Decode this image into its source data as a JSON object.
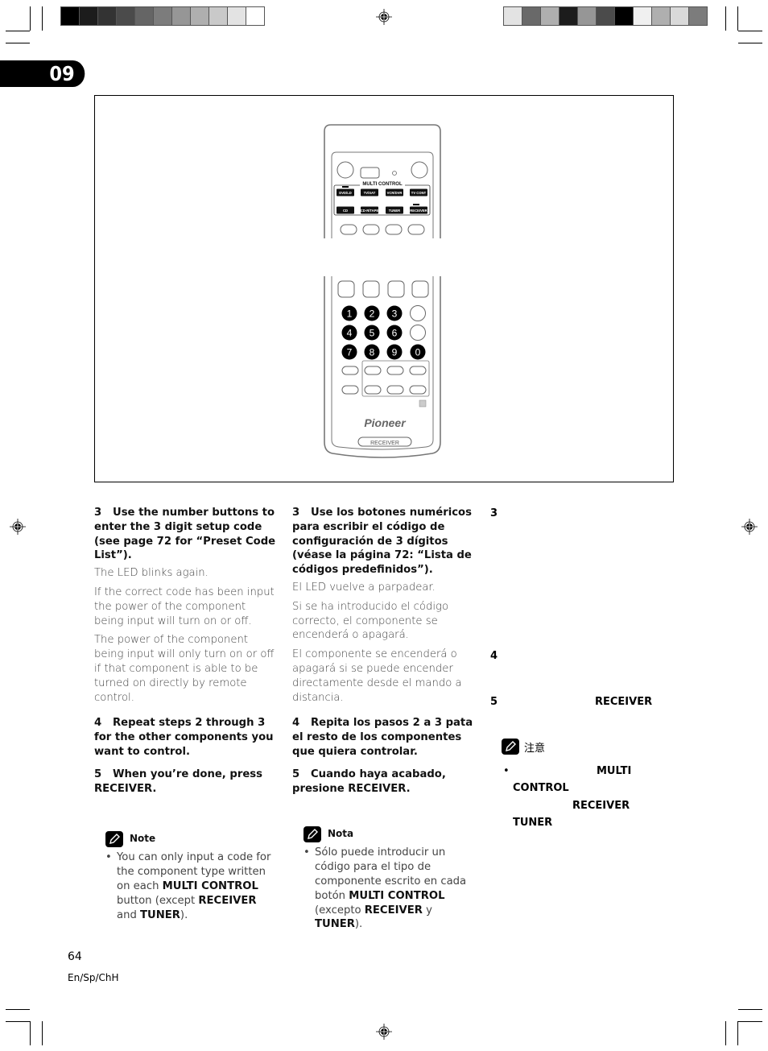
{
  "chapter": "09",
  "color_bar_left": [
    "#000000",
    "#1c1c1c",
    "#333333",
    "#4b4b4b",
    "#656565",
    "#7c7c7c",
    "#969696",
    "#afafaf",
    "#c9c9c9",
    "#e3e3e3",
    "#ffffff"
  ],
  "color_bar_right": [
    "#e3e3e3",
    "#696969",
    "#afafaf",
    "#1c1c1c",
    "#969696",
    "#4b4b4b",
    "#000000",
    "#f0f0f0",
    "#afafaf",
    "#d9d9d9",
    "#7c7c7c"
  ],
  "remote": {
    "multi_control_label": "MULTI CONTROL",
    "row1": [
      "DVD/LD",
      "TV/SAT",
      "VCR/DVR",
      "TV CONT"
    ],
    "row2": [
      "CD",
      "CD-R/TAPE",
      "TUNER",
      "RECEIVER"
    ],
    "numbers": [
      "1",
      "2",
      "3",
      "4",
      "5",
      "6",
      "7",
      "8",
      "9",
      "0"
    ],
    "brand": "Pioneer",
    "receiver_button": "RECEIVER"
  },
  "english": {
    "step3_num": "3",
    "step3_title": "Use the number buttons to enter the 3 digit setup code (see page 72 for “Preset Code List”).",
    "step3_p1": "The LED blinks again.",
    "step3_p2": "If the correct code has been input the power of the component being input will turn on or off.",
    "step3_p3": "The power of the component being input will only turn on or off if that component is able to be turned on directly by remote control.",
    "step4_num": "4",
    "step4_title": "Repeat steps 2 through 3 for the other components you want to control.",
    "step5_num": "5",
    "step5_title": "When you’re done, press RECEIVER.",
    "note_label": "Note",
    "note_text_1": "You can only input a code for the component type written on each ",
    "note_bold_1": "MULTI CONTROL",
    "note_text_2": " button (except ",
    "note_bold_2": "RECEIVER",
    "note_text_3": " and ",
    "note_bold_3": "TUNER",
    "note_text_4": ")."
  },
  "spanish": {
    "step3_num": "3",
    "step3_title": "Use los botones numéricos para escribir el código de configuración de 3 dígitos (véase la página 72: “Lista de códigos predefinidos”).",
    "step3_p1": "El LED vuelve a parpadear.",
    "step3_p2": "Si se ha introducido el código correcto, el componente se encenderá o apagará.",
    "step3_p3": "El componente se encenderá o apagará si se puede encender directamente desde el mando a distancia.",
    "step4_num": "4",
    "step4_title": "Repita los pasos 2 a 3 pata el resto de los componentes que quiera controlar.",
    "step5_num": "5",
    "step5_title": "Cuando haya acabado, presione RECEIVER.",
    "note_label": "Nota",
    "note_text_1": "Sólo puede introducir un código para el tipo de componente escrito en cada botón ",
    "note_bold_1": "MULTI CONTROL",
    "note_text_2": " (excepto ",
    "note_bold_2": "RECEIVER",
    "note_text_3": " y ",
    "note_bold_3": "TUNER",
    "note_text_4": ")."
  },
  "chinese": {
    "step3_num": "3",
    "step4_num": "4",
    "step5_num": "5",
    "step5_bold": "RECEIVER",
    "note_label": "注意",
    "bullet_multi": "MULTI",
    "bullet_control": "CONTROL",
    "bullet_receiver": "RECEIVER",
    "bullet_tuner": "TUNER"
  },
  "footer": {
    "page_number": "64",
    "language_code": "En/Sp/ChH"
  }
}
